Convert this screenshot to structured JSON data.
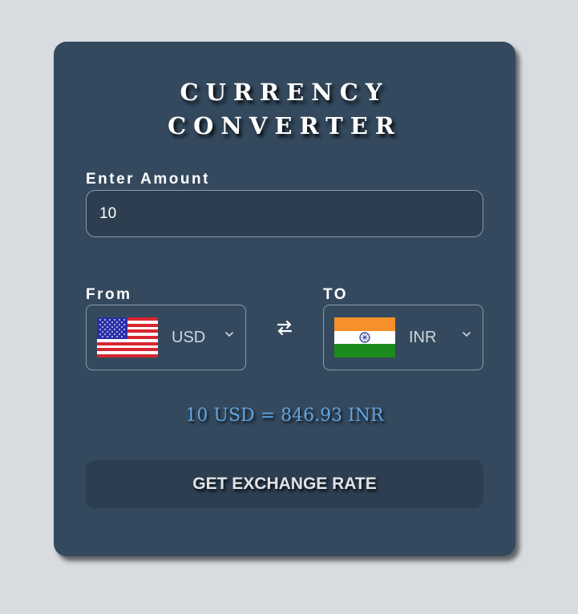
{
  "title": {
    "line1": "CURRENCY",
    "line2": "CONVERTER"
  },
  "amount": {
    "label": "Enter Amount",
    "value": "10"
  },
  "from": {
    "label": "From",
    "currency": "USD",
    "flag": "us-flag-icon"
  },
  "to": {
    "label": "TO",
    "currency": "INR",
    "flag": "india-flag-icon"
  },
  "swap_icon": "swap-arrows-icon",
  "result": "10 USD = 846.93 INR",
  "button": {
    "label": "GET EXCHANGE RATE"
  },
  "colors": {
    "page_background": "#d8dbe0",
    "card_background": "#34495e",
    "field_background": "#2c3e50",
    "result_text": "#62a4e0"
  }
}
